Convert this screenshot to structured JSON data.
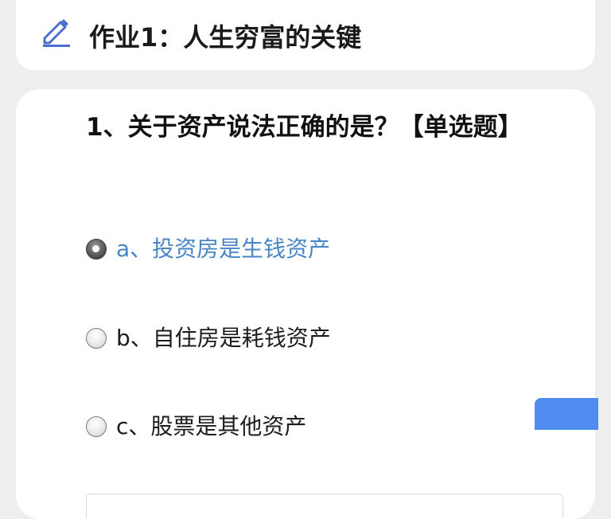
{
  "header": {
    "title": "作业1：人生穷富的关键",
    "icon": "edit-pencil-icon",
    "icon_color": "#4a6fd1"
  },
  "question": {
    "text": "1、关于资产说法正确的是？【单选题】",
    "options": [
      {
        "label": "a、投资房是生钱资产",
        "selected": true
      },
      {
        "label": "b、自住房是耗钱资产",
        "selected": false
      },
      {
        "label": "c、股票是其他资产",
        "selected": false
      }
    ],
    "selected_color": "#4a86c5"
  },
  "colors": {
    "background": "#eeeeee",
    "card": "#ffffff",
    "accent_button": "#4f8ef0"
  }
}
